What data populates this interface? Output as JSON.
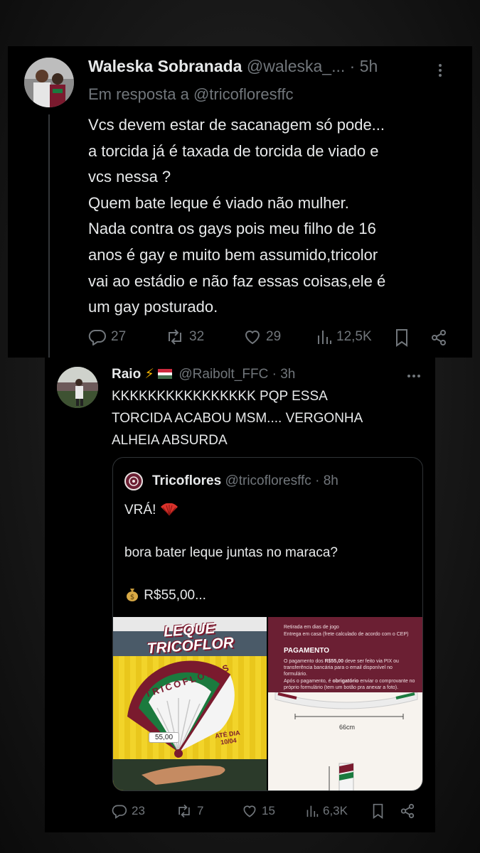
{
  "post1": {
    "author_name": "Waleska Sobranada",
    "handle": "@waleska_...",
    "separator": "·",
    "time": "5h",
    "reply_prefix": "Em resposta a ",
    "reply_to": "@tricofloresffc",
    "text": "Vcs devem estar de sacanagem só pode...\na torcida já é taxada de torcida de viado e\nvcs nessa ?\nQuem bate leque é viado não mulher.\nNada contra os gays pois meu filho de 16\nanos é gay e muito bem assumido,tricolor\nvai ao estádio e não faz essas coisas,ele é\num gay posturado.",
    "replies": "27",
    "reposts": "32",
    "likes": "29",
    "views": "12,5K"
  },
  "post2": {
    "author_name": "Raio",
    "name_emojis": "⚡",
    "handle": "@Raibolt_FFC",
    "separator": "·",
    "time": "3h",
    "text": "KKKKKKKKKKKKKKKK PQP ESSA\nTORCIDA ACABOU MSM.... VERGONHA\nALHEIA ABSURDA",
    "replies": "23",
    "reposts": "7",
    "likes": "15",
    "views": "6,3K"
  },
  "quoted": {
    "author_name": "Tricoflores",
    "handle": "@tricofloresffc",
    "separator": "·",
    "time": "8h",
    "line1": "VRÁ! ",
    "line2": "bora bater leque juntas no maraca?",
    "line3": " R$55,00...",
    "image_left": {
      "title_line1": "LEQUE",
      "title_line2": "TRICOFLOR",
      "fan_text": "TRICOFLORES",
      "price_tag": "55,00",
      "date_line1": "ATÉ DIA",
      "date_line2": "10/04"
    },
    "image_right": {
      "bullet1": "Retirada em dias de jogo",
      "bullet2": "Entrega em casa (frete calculado de acordo com o CEP)",
      "heading": "PAGAMENTO",
      "para1_a": "O pagamento dos ",
      "para1_price": "R$55,00",
      "para1_b": " deve ser feito via PIX ou transferência bancária para o email disponível no formulário.",
      "para2_a": "Após o pagamento, é ",
      "para2_bold": "obrigatório",
      "para2_b": " enviar o comprovante no próprio formulário (tem um botão pra anexar a foto).",
      "dimension": "66cm"
    }
  },
  "colors": {
    "text": "#e7e9ea",
    "muted": "#71767b",
    "fan_maroon": "#7a1a2e",
    "fan_green": "#1b7a3e",
    "poster_yellow": "#f2d42a"
  },
  "icons": [
    "reply-icon",
    "repost-icon",
    "like-icon",
    "views-icon",
    "bookmark-icon",
    "share-icon",
    "more-icon",
    "fan-emoji-icon",
    "money-bag-icon",
    "lightning-icon",
    "hungary-flag-icon"
  ]
}
